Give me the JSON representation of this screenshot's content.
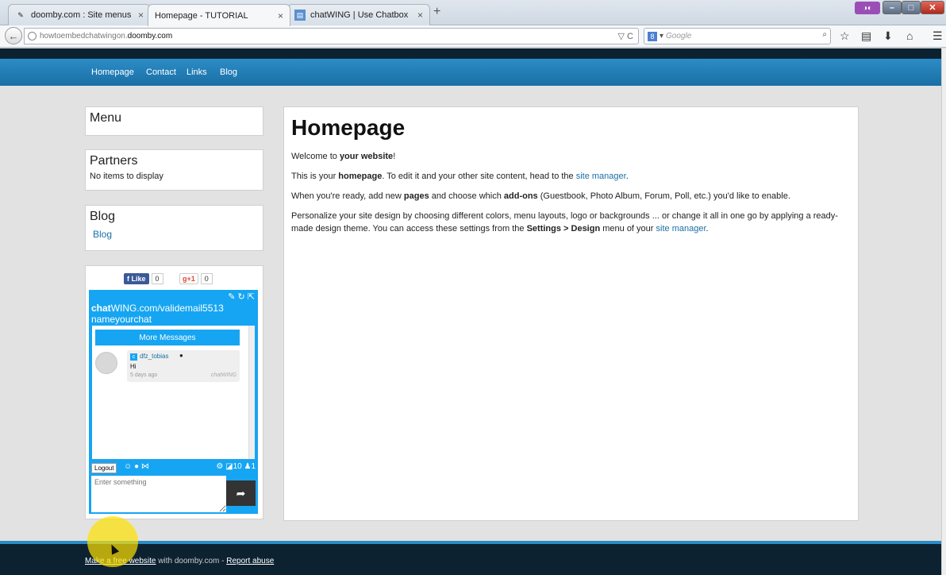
{
  "browser": {
    "tabs": [
      {
        "title": "doomby.com : Site menus",
        "active": false,
        "icon": "pencil-icon"
      },
      {
        "title": "Homepage - TUTORIAL",
        "active": true,
        "icon": "blank-page-icon"
      },
      {
        "title": "chatWING | Use Chatbox",
        "active": false,
        "icon": "chatwing-icon"
      }
    ],
    "new_tab": "+",
    "close_glyph": "×",
    "url_prefix": "howtoembedchatwingon.",
    "url_host": "doomby.com",
    "url_tools": "▽ C",
    "search_engine": "8",
    "search_placeholder": "Google",
    "search_engine_arrow": "▾"
  },
  "site": {
    "menu": [
      "Homepage",
      "Contact",
      "Links",
      "Blog"
    ],
    "sidebar": {
      "menu_title": "Menu",
      "partners_title": "Partners",
      "partners_empty": "No items to display",
      "blog_title": "Blog",
      "blog_link": "Blog"
    },
    "social": {
      "like": "Like",
      "like_count": "0",
      "plus": "g+1",
      "plus_count": "0"
    },
    "chat": {
      "title_bold": "chat",
      "title_rest": "WING.com/validemail5513",
      "title_line2": "nameyourchat",
      "more_messages": "More Messages",
      "message": {
        "user": "dfz_tobias",
        "text": "Hi",
        "time": "5 days ago",
        "brand": "chatWING"
      },
      "logout": "Logout",
      "rss_count": "10",
      "user_count": "1",
      "input_placeholder": "Enter something"
    },
    "main": {
      "title": "Homepage",
      "p1_pre": "Welcome to ",
      "p1_bold": "your website",
      "p1_post": "!",
      "p2_pre": "This is your ",
      "p2_bold": "homepage",
      "p2_mid": ". To edit it and your other site content, head to the ",
      "p2_link": "site manager",
      "p2_post": ".",
      "p3_pre": "When you're ready, add new ",
      "p3_bold1": "pages",
      "p3_mid": " and choose which ",
      "p3_bold2": "add-ons",
      "p3_post": " (Guestbook, Photo Album, Forum, Poll, etc.) you'd like to enable.",
      "p4_pre": "Personalize your site design by choosing different colors, menu layouts, logo or backgrounds ... or change it all in one go by applying a ready-made design theme. You can access these settings from the ",
      "p4_bold": "Settings > Design",
      "p4_mid": " menu of your ",
      "p4_link": "site manager",
      "p4_post": "."
    },
    "footer": {
      "link1": "Make a free website",
      "mid": " with doomby.com - ",
      "link2": "Report abuse"
    }
  },
  "colors": {
    "accent": "#2c8cc6",
    "dark": "#0d2231",
    "chat": "#16a5f2"
  }
}
